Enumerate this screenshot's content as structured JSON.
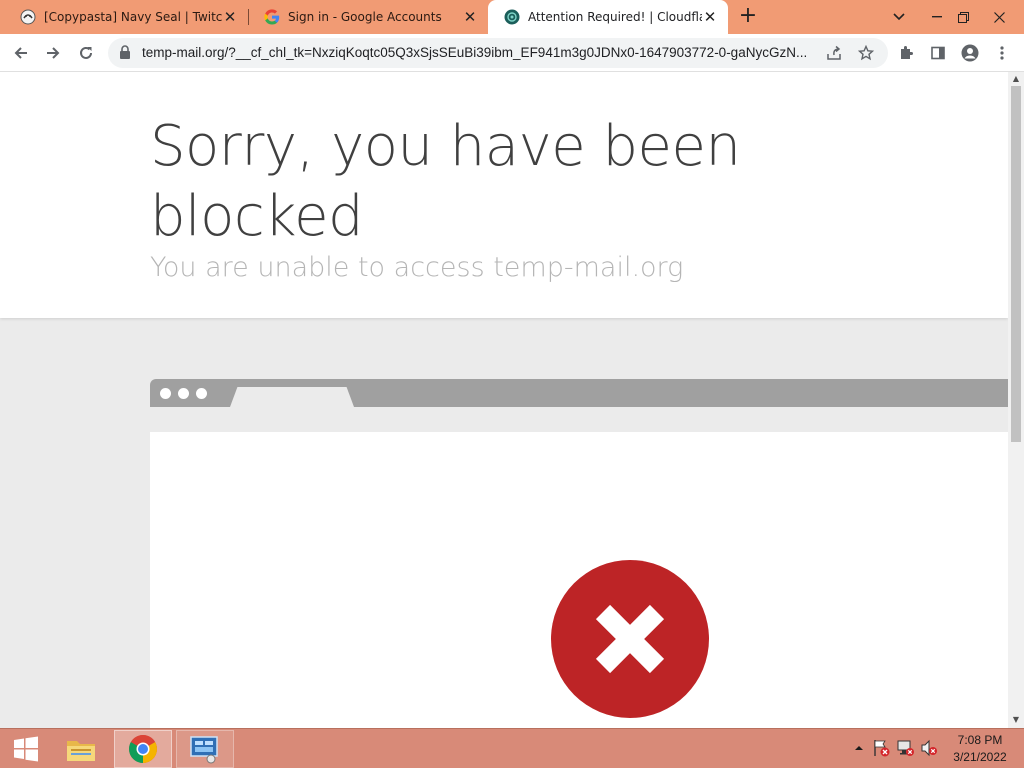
{
  "tabs": [
    {
      "title": "[Copypasta] Navy Seal | TwitchQuotes",
      "favicon": "twitchquotes-icon",
      "active": false
    },
    {
      "title": "Sign in - Google Accounts",
      "favicon": "google-icon",
      "active": false
    },
    {
      "title": "Attention Required! | Cloudflare",
      "favicon": "cloudflare-icon",
      "active": true
    }
  ],
  "toolbar": {
    "url": "temp-mail.org/?__cf_chl_tk=NxziqKoqtc05Q3xSjsSEuBi39ibm_EF941m3g0JDNx0-1647903772-0-gaNycGzN..."
  },
  "page": {
    "heading": "Sorry, you have been blocked",
    "subheading": "You are unable to access temp-mail.org"
  },
  "taskbar": {
    "time": "7:08 PM",
    "date": "3/21/2022"
  },
  "colors": {
    "tabstrip": "#f19b74",
    "taskbar": "#d88a78",
    "blocked_red": "#bd2426"
  }
}
